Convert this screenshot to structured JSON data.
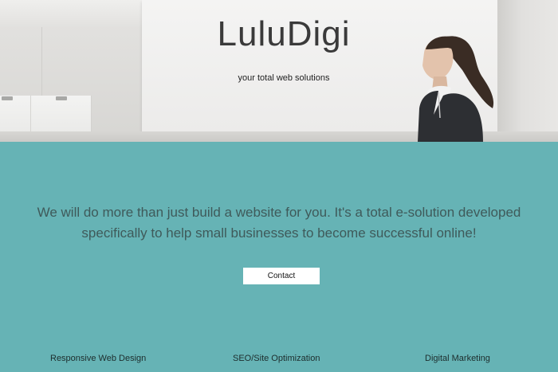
{
  "hero": {
    "brand": "LuluDigi",
    "tagline": "your total web solutions"
  },
  "main": {
    "pitch_line1": "We will do more than just build a website for you. It's a total e-solution developed",
    "pitch_line2": "specifically to help small businesses to become successful online!",
    "contact_label": "Contact"
  },
  "services": [
    {
      "label": "Responsive Web Design"
    },
    {
      "label": "SEO/Site Optimization"
    },
    {
      "label": "Digital Marketing"
    }
  ],
  "colors": {
    "accent_teal": "#66b3b5",
    "button_bg": "#ffffff"
  }
}
